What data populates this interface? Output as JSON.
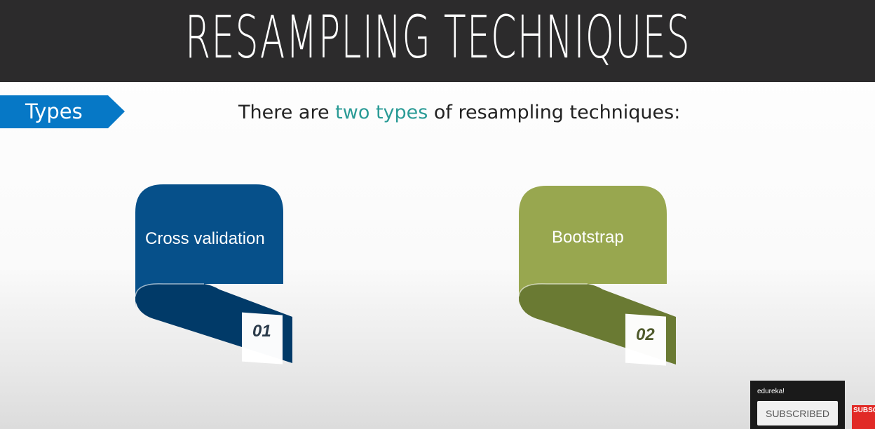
{
  "slide": {
    "title": "RESAMPLING TECHNIQUES",
    "tag_label": "Types",
    "subtitle_before": "There are ",
    "subtitle_highlight": "two types",
    "subtitle_after": " of resampling techniques:"
  },
  "cards": [
    {
      "label": "Cross validation",
      "number": "01",
      "color": "#06508a",
      "dark_color": "#013a68"
    },
    {
      "label": "Bootstrap",
      "number": "02",
      "color": "#98a74f",
      "dark_color": "#6a7a33"
    }
  ],
  "youtube": {
    "channel": "edureka!",
    "button_label": "SUBSCRIBED",
    "logo_text": "SUBSCRIBE"
  },
  "colors": {
    "title_bar": "#2c2b2c",
    "tag": "#0678c6",
    "highlight": "#2a9b96"
  }
}
